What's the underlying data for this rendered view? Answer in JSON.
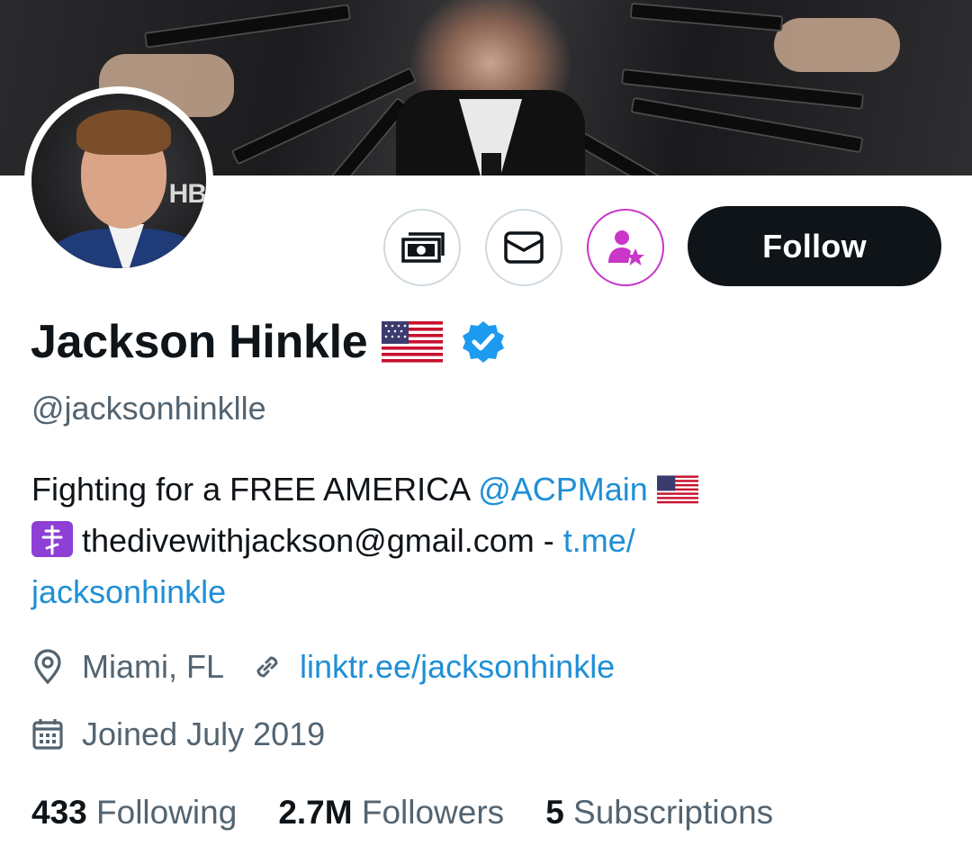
{
  "profile": {
    "name": "Jackson Hinkle",
    "handle": "@jacksonhinklle",
    "bio": {
      "line1_text": "Fighting for a FREE AMERICA",
      "line1_mention": "@ACPMain",
      "line2_email": "thedivewithjackson@gmail.com -",
      "line2_link": "t.me/",
      "line3_link": "jacksonhinkle"
    },
    "location": "Miami, FL",
    "website": "linktr.ee/jacksonhinkle",
    "joined": "Joined July 2019"
  },
  "actions": {
    "follow_label": "Follow"
  },
  "stats": {
    "following_count": "433",
    "following_label": "Following",
    "followers_count": "2.7M",
    "followers_label": "Followers",
    "subscriptions_count": "5",
    "subscriptions_label": "Subscriptions"
  },
  "icons": {
    "tip": "money-icon",
    "message": "mail-icon",
    "subscribe": "user-star-icon",
    "verified": "verified-badge-icon",
    "location": "location-pin-icon",
    "link": "link-icon",
    "calendar": "calendar-icon"
  },
  "colors": {
    "link": "#1f8fd6",
    "verified": "#1d9bf0",
    "subscribe_accent": "#c936c9",
    "secondary_text": "#536471",
    "primary_text": "#0f1419"
  }
}
